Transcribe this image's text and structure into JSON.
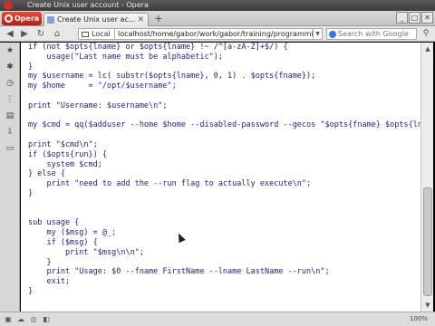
{
  "window": {
    "title": "Create Unix user account - Opera"
  },
  "browser": {
    "menu_label": "Opera",
    "tab": {
      "title": "Create Unix user ac...",
      "close": "✕"
    },
    "new_tab": "+",
    "window_controls": [
      "_",
      "□",
      "✕"
    ],
    "nav": {
      "back": "◀",
      "forward": "▶",
      "reload": "↻",
      "home": "⌂"
    },
    "security_badge": "Local",
    "url": "localhost/home/gabor/work/gabor/training/programming_perl",
    "search": {
      "placeholder": "Search with Google",
      "go": "⚲"
    }
  },
  "side_panel": {
    "icons": [
      "bookmarks-icon",
      "gear-icon",
      "history-icon",
      "share-icon",
      "notes-icon",
      "downloads-icon",
      "windows-icon"
    ]
  },
  "code_lines": [
    "if (not $opts{lname} or $opts{lname} !~ /^[a-zA-Z]+$/) {",
    "    usage(\"Last name must be alphabetic\");",
    "}",
    "my $username = lc( substr($opts{lname}, 0, 1) . $opts{fname});",
    "my $home     = \"/opt/$username\";",
    "",
    "print \"Username: $username\\n\";",
    "",
    "my $cmd = qq($adduser --home $home --disabled-password --gecos \"$opts{fname} $opts{lname}\" $username);",
    "",
    "print \"$cmd\\n\";",
    "if ($opts{run}) {",
    "    system $cmd;",
    "} else {",
    "    print \"need to add the --run flag to actually execute\\n\";",
    "}",
    "",
    "",
    "sub usage {",
    "    my ($msg) = @_;",
    "    if ($msg) {",
    "        print \"$msg\\n\\n\";",
    "    }",
    "    print \"Usage: $0 --fname FirstName --lname LastName --run\\n\";",
    "    exit;",
    "}"
  ],
  "status_bar": {
    "zoom": "100%"
  }
}
